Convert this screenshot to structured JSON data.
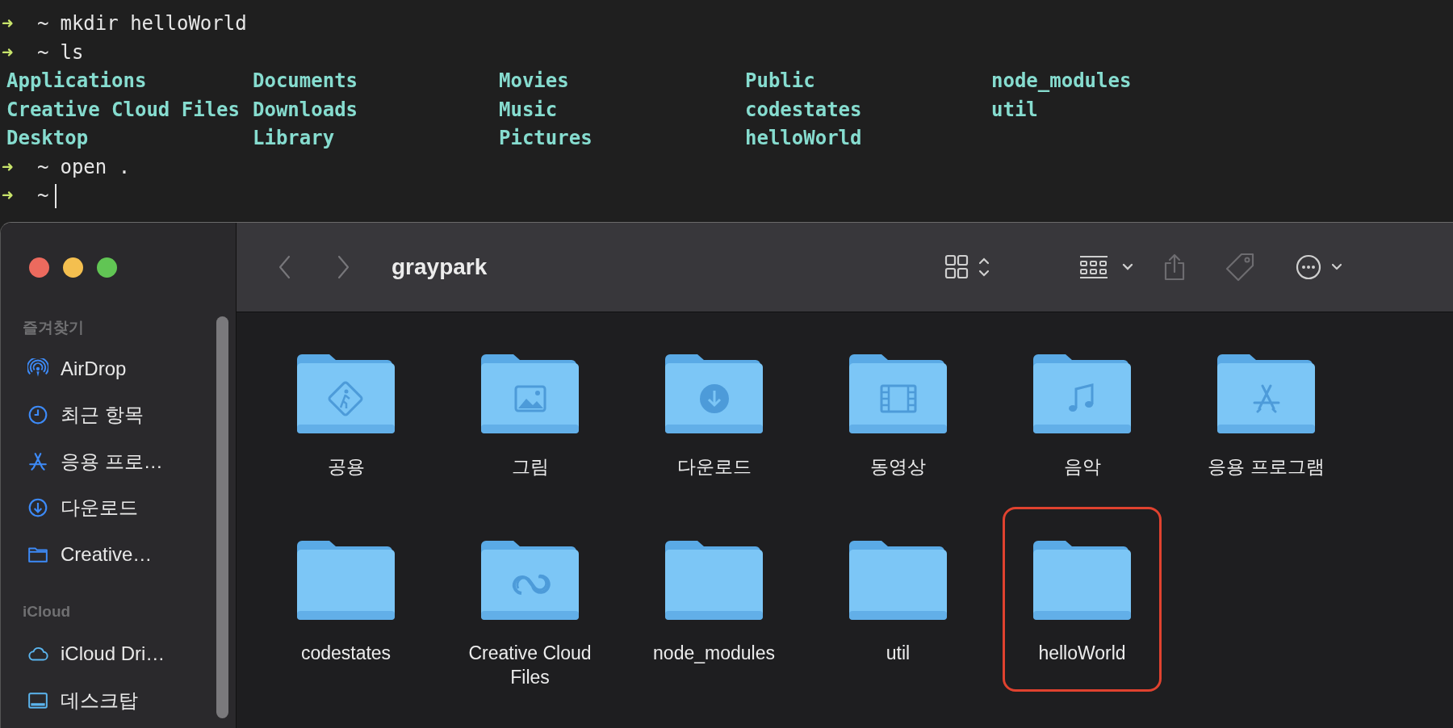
{
  "terminal": {
    "lines": [
      {
        "kind": "prompt",
        "arrow": "➜",
        "cwd": "~",
        "command": "mkdir helloWorld"
      },
      {
        "kind": "prompt",
        "arrow": "➜",
        "cwd": "~",
        "command": "ls"
      },
      {
        "kind": "listing",
        "cells": [
          "Applications",
          "Documents",
          "Movies",
          "Public",
          "node_modules"
        ]
      },
      {
        "kind": "listing",
        "cells": [
          "Creative Cloud Files",
          "Downloads",
          "Music",
          "codestates",
          "util"
        ]
      },
      {
        "kind": "listing",
        "cells": [
          "Desktop",
          "Library",
          "Pictures",
          "helloWorld"
        ]
      },
      {
        "kind": "prompt",
        "arrow": "➜",
        "cwd": "~",
        "command": "open ."
      },
      {
        "kind": "prompt",
        "arrow": "➜",
        "cwd": "~",
        "cursor": true
      }
    ]
  },
  "finder": {
    "title": "graypark",
    "sidebar": {
      "sections": [
        {
          "header": "즐겨찾기",
          "items": [
            {
              "label": "AirDrop",
              "kind": "airdrop"
            },
            {
              "label": "최근 항목",
              "kind": "clock"
            },
            {
              "label": "응용 프로…",
              "kind": "apps"
            },
            {
              "label": "다운로드",
              "kind": "download"
            },
            {
              "label": "Creative…",
              "kind": "folder"
            }
          ]
        },
        {
          "header": "iCloud",
          "items": [
            {
              "label": "iCloud Dri…",
              "kind": "cloud"
            },
            {
              "label": "데스크탑",
              "kind": "desktop"
            }
          ]
        }
      ]
    },
    "folders": [
      {
        "name": "공용",
        "kind": "public",
        "highlighted": false
      },
      {
        "name": "그림",
        "kind": "pictures",
        "highlighted": false
      },
      {
        "name": "다운로드",
        "kind": "downloads",
        "highlighted": false
      },
      {
        "name": "동영상",
        "kind": "movies",
        "highlighted": false
      },
      {
        "name": "음악",
        "kind": "music",
        "highlighted": false
      },
      {
        "name": "응용 프로그램",
        "kind": "applications",
        "highlighted": false
      },
      {
        "name": "codestates",
        "kind": "plain",
        "highlighted": false
      },
      {
        "name": "Creative Cloud Files",
        "kind": "creative-cloud",
        "highlighted": false
      },
      {
        "name": "node_modules",
        "kind": "plain",
        "highlighted": false
      },
      {
        "name": "util",
        "kind": "plain",
        "highlighted": false
      },
      {
        "name": "helloWorld",
        "kind": "plain",
        "highlighted": true
      }
    ]
  }
}
